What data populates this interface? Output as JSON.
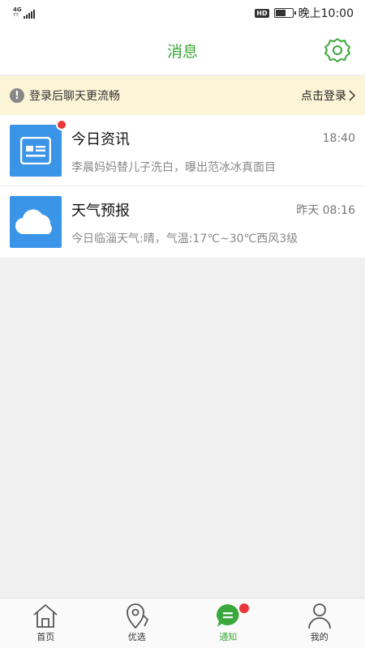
{
  "status_bar": {
    "network": "4G",
    "network_sub": "TT",
    "hd": "HD",
    "battery_level": 0.6,
    "time": "晚上10:00"
  },
  "header": {
    "title": "消息",
    "settings_icon": "gear-icon",
    "accent": "#3aa83a"
  },
  "login_banner": {
    "text": "登录后聊天更流畅",
    "link": "点击登录",
    "icon": "exclamation-icon"
  },
  "messages": [
    {
      "title": "今日资讯",
      "time": "18:40",
      "preview": "李晨妈妈替儿子洗白，曝出范冰冰真面目",
      "icon": "news-icon",
      "unread": true
    },
    {
      "title": "天气预报",
      "time": "昨天 08:16",
      "preview": "今日临淄天气:晴，气温:17℃~30℃西风3级",
      "icon": "cloud-icon",
      "unread": false
    }
  ],
  "tabs": [
    {
      "label": "首页",
      "icon": "home-icon"
    },
    {
      "label": "优选",
      "icon": "location-pin-icon"
    },
    {
      "label": "通知",
      "icon": "chat-bubble-icon",
      "active": true
    },
    {
      "label": "我的",
      "icon": "user-icon"
    }
  ],
  "colors": {
    "blue_icon": "#3a94e8",
    "red_badge": "#e8363a",
    "banner_bg": "#fcf4d6"
  }
}
